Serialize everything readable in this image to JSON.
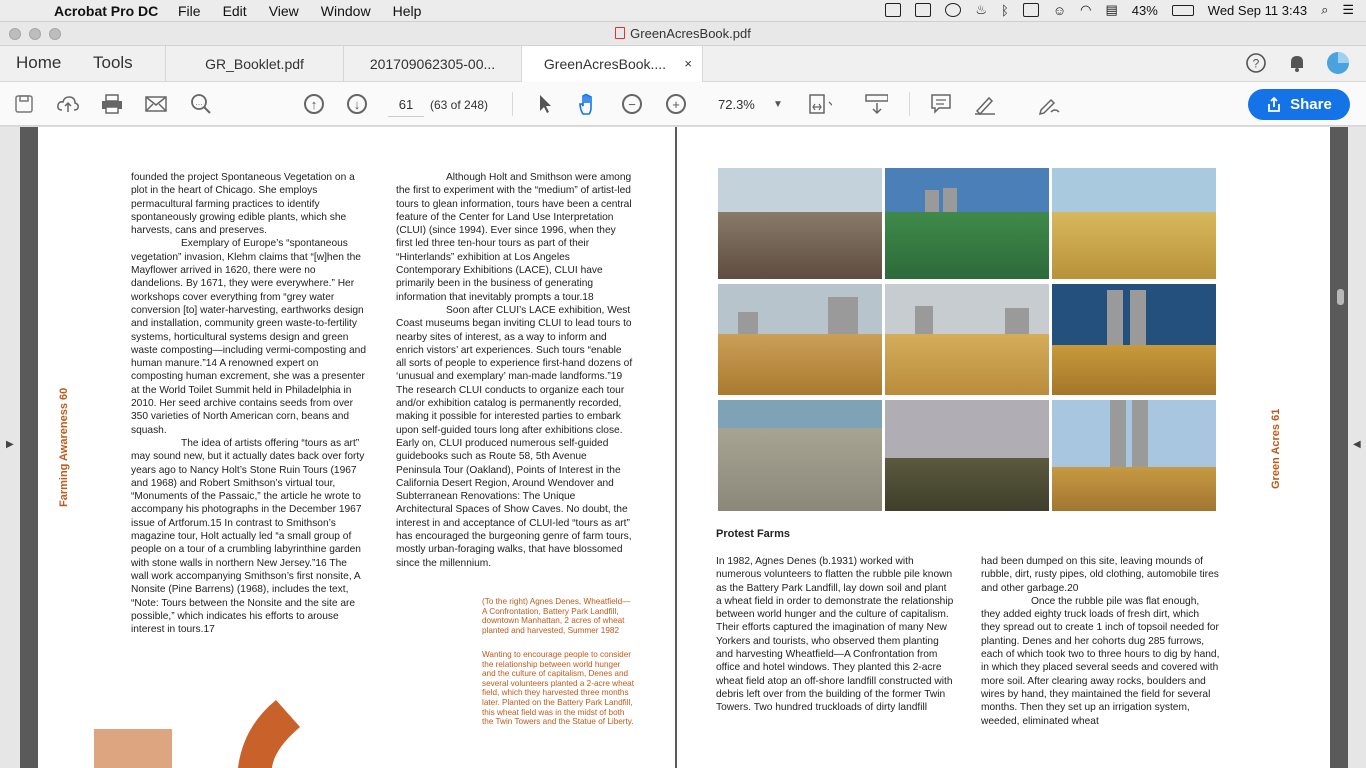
{
  "menubar": {
    "apple": "",
    "app_name": "Acrobat Pro DC",
    "menus": [
      "File",
      "Edit",
      "View",
      "Window",
      "Help"
    ],
    "battery": "43%",
    "datetime": "Wed Sep 11  3:43"
  },
  "window": {
    "title": "GreenAcresBook.pdf"
  },
  "tabs": {
    "home": "Home",
    "tools": "Tools",
    "docs": [
      {
        "label": "GR_Booklet.pdf"
      },
      {
        "label": "201709062305-00..."
      },
      {
        "label": "GreenAcresBook...."
      }
    ],
    "close": "×"
  },
  "toolbar": {
    "page_number": "61",
    "page_count": "(63 of 248)",
    "zoom": "72.3%",
    "share_label": "Share"
  },
  "page_left": {
    "runner": "Farming Awareness   60",
    "col1": [
      {
        "t": "founded the project Spontaneous Vegetation on a plot in the heart of Chicago. She employs permacultural farming practices to identify spontaneously growing edible plants, which she harvests, cans and preserves.",
        "ind": false
      },
      {
        "t": "Exemplary of Europe’s “spontaneous vegetation” invasion, Klehm claims that “[w]hen the Mayflower arrived in 1620, there were no dandelions. By 1671, they were everywhere.” Her workshops cover everything from “grey water conversion [to] water-harvesting, earthworks design and installation, community green waste-to-fertility systems, horticultural systems design and green waste composting—including vermi-composting and human manure.”14 A renowned expert on composting human excrement, she was a presenter at the World Toilet Summit held in Philadelphia in 2010. Her seed archive contains seeds from over 350 varieties of North American corn, beans and squash.",
        "ind": true
      },
      {
        "t": "The idea of artists offering “tours as art” may sound new, but it actually dates back over forty years ago to Nancy Holt’s Stone Ruin Tours (1967 and 1968) and Robert Smithson’s virtual tour, “Monuments of the Passaic,” the article he wrote to accompany his photographs in the December 1967 issue of Artforum.15 In contrast to Smithson’s magazine tour, Holt actually led “a small group of people on a tour of a crumbling labyrinthine garden with stone walls in northern New Jersey.”16 The wall work accompanying Smithson’s first nonsite, A Nonsite (Pine Barrens) (1968), includes the text, “Note: Tours between the Nonsite and the site are possible,” which indicates his efforts to arouse interest in tours.17",
        "ind": true
      }
    ],
    "col2": [
      {
        "t": "Although Holt and Smithson were among the first to experiment with the “medium” of artist-led tours to glean information, tours have been a central feature of the Center for Land Use Interpretation (CLUI) (since 1994). Ever since 1996, when they first led three ten-hour tours as part of their “Hinterlands” exhibition at Los Angeles Contemporary Exhibitions (LACE), CLUI have primarily been in the business of generating information that inevitably prompts a tour.18",
        "ind": true
      },
      {
        "t": "Soon after CLUI’s LACE exhibition, West Coast museums began inviting CLUI to lead tours to nearby sites of interest, as a way to inform and enrich vistors’ art experiences. Such tours “enable all sorts of people to experience first-hand dozens of ‘unusual and exemplary’ man-made landforms.”19 The research CLUI conducts to organize each tour and/or exhibition catalog is permanently recorded, making it possible for interested parties to embark upon self-guided tours long after exhibitions close. Early on, CLUI produced numerous self-guided guidebooks such as Route 58, 5th Avenue Peninsula Tour (Oakland), Points of Interest in the California Desert Region, Around Wendover and Subterranean Renovations: The Unique Architectural Spaces of Show Caves. No doubt, the interest in and acceptance of CLUI-led “tours as art” has encouraged the burgeoning genre of farm tours, mostly urban-foraging walks, that have blossomed since the millennium.",
        "ind": true
      }
    ],
    "caption1": "(To the right) Agnes Denes, Wheatfield—A Confrontation, Battery Park Landfill, downtown Manhattan, 2 acres of wheat planted and harvested, Summer 1982",
    "caption2": "Wanting to encourage people to consider the relationship between world hunger and the culture of capitalism, Denes and several volunteers planted a 2-acre wheat field, which they harvested three months later. Planted on the Battery Park Landfill, this wheat field was in the midst of both the Twin Towers and the Statue of Liberty."
  },
  "page_right": {
    "runner": "Green Acres   61",
    "heading": "Protest Farms",
    "col1": [
      {
        "t": "In 1982, Agnes Denes (b.1931) worked with numerous volunteers to flatten the rubble pile known as the Battery Park Landfill, lay down soil and plant a wheat field in order to demonstrate the relationship between world hunger and the culture of capitalism. Their efforts captured the imagination of many New Yorkers and tourists, who observed them planting and harvesting Wheatfield—A Confrontation from office and hotel windows. They planted this 2-acre wheat field atop an off-shore landfill constructed with debris left over from the building of the former Twin Towers. Two hundred truckloads of dirty landfill",
        "ind": false
      }
    ],
    "col2": [
      {
        "t": "had been dumped on this site, leaving mounds of rubble, dirt, rusty pipes, old clothing, automobile tires and other garbage.20",
        "ind": false
      },
      {
        "t": "Once the rubble pile was flat enough, they added eighty truck loads of fresh dirt, which they spread out to create 1 inch of topsoil needed for planting. Denes and her cohorts dug 285 furrows, each of which took two to three hours to dig by hand, in which they placed several seeds and covered with more soil. After clearing away rocks, boulders and wires by hand, they maintained the field for several months. Then they set up an irrigation system, weeded, eliminated wheat",
        "ind": true
      }
    ]
  },
  "colors": {
    "accent": "#1473e6",
    "runner": "#c05a1a"
  }
}
